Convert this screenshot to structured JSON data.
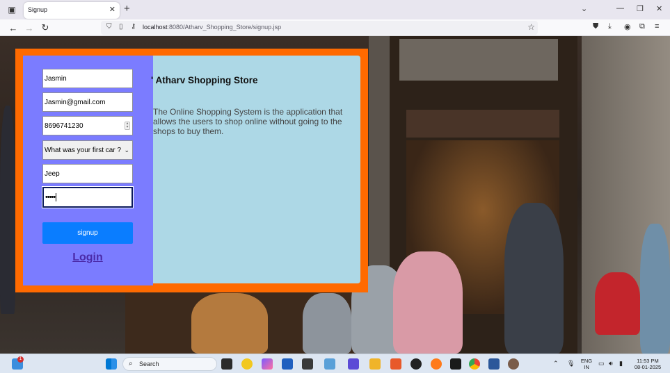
{
  "browser": {
    "tab_title": "Signup",
    "url_host": "localhost",
    "url_rest": ":8080/Atharv_Shopping_Store/signup.jsp"
  },
  "form": {
    "name_value": "Jasmin",
    "email_value": "Jasmin@gmail.com",
    "phone_value": "8696741230",
    "question_selected": "What was your first car ?",
    "answer_value": "Jeep",
    "password_masked": "•••••",
    "signup_label": "signup",
    "login_label": "Login"
  },
  "info": {
    "title": "' Atharv Shopping Store",
    "description": "The Online Shopping System is the application that allows the users to shop online without going to the shops to buy them."
  },
  "taskbar": {
    "search_label": "Search",
    "notification_count": "1",
    "language_line1": "ENG",
    "language_line2": "IN",
    "time": "11:53 PM",
    "date": "08-01-2025"
  },
  "colors": {
    "outer_frame": "#ff6a00",
    "form_panel": "#7b7cff",
    "info_panel": "#add8e6",
    "signup_button": "#0a7dff",
    "login_link": "#4b2aa8"
  }
}
